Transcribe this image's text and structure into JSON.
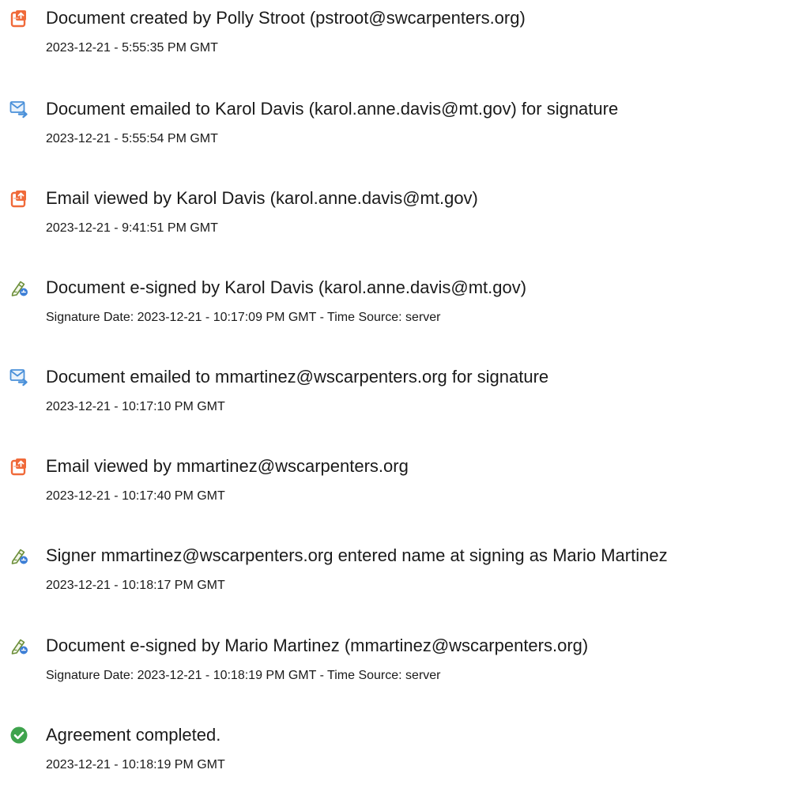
{
  "audit_trail": {
    "events": [
      {
        "icon": "document-created-icon",
        "title": "Document created by Polly Stroot (pstroot@swcarpenters.org)",
        "detail": "2023-12-21 - 5:55:35 PM GMT"
      },
      {
        "icon": "email-sent-icon",
        "title": "Document emailed to Karol Davis (karol.anne.davis@mt.gov) for signature",
        "detail": "2023-12-21 - 5:55:54 PM GMT"
      },
      {
        "icon": "document-viewed-icon",
        "title": "Email viewed by Karol Davis (karol.anne.davis@mt.gov)",
        "detail": "2023-12-21 - 9:41:51 PM GMT"
      },
      {
        "icon": "e-sign-icon",
        "title": "Document e-signed by Karol Davis (karol.anne.davis@mt.gov)",
        "detail": "Signature Date: 2023-12-21 - 10:17:09 PM GMT - Time Source: server"
      },
      {
        "icon": "email-sent-icon",
        "title": "Document emailed to mmartinez@wscarpenters.org for signature",
        "detail": "2023-12-21 - 10:17:10 PM GMT"
      },
      {
        "icon": "document-viewed-icon",
        "title": "Email viewed by mmartinez@wscarpenters.org",
        "detail": "2023-12-21 - 10:17:40 PM GMT"
      },
      {
        "icon": "e-sign-icon",
        "title": "Signer mmartinez@wscarpenters.org entered name at signing as Mario Martinez",
        "detail": "2023-12-21 - 10:18:17 PM GMT"
      },
      {
        "icon": "e-sign-icon",
        "title": "Document e-signed by Mario Martinez (mmartinez@wscarpenters.org)",
        "detail": "Signature Date: 2023-12-21 - 10:18:19 PM GMT - Time Source: server"
      },
      {
        "icon": "check-circle-icon",
        "title": "Agreement completed.",
        "detail": "2023-12-21 - 10:18:19 PM GMT"
      }
    ],
    "colors": {
      "document_icon": "#f06a3a",
      "email_icon": "#4a90d9",
      "sign_icon_pen": "#6c8f3a",
      "sign_icon_badge": "#3d7fd6",
      "check_icon": "#3fa34d",
      "text": "#1a1a1a"
    }
  }
}
